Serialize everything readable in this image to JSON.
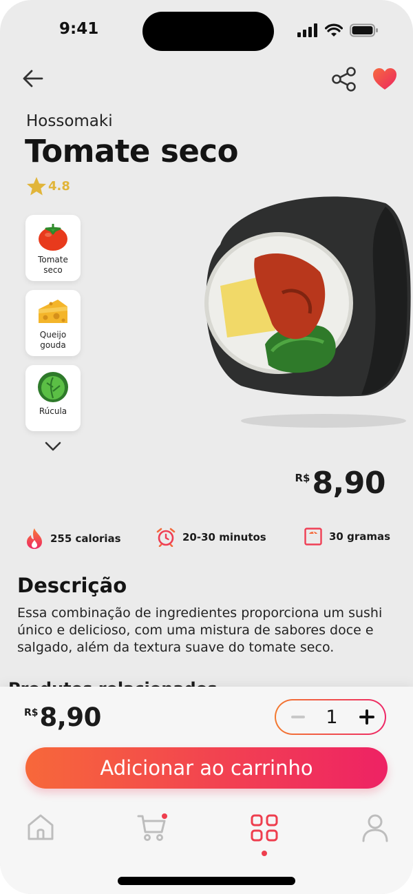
{
  "status": {
    "time": "9:41"
  },
  "product": {
    "category": "Hossomaki",
    "name": "Tomate seco",
    "rating": "4.8",
    "currency": "R$",
    "price": "8,90"
  },
  "ingredients": [
    {
      "label": "Tomate seco",
      "icon": "tomato-icon"
    },
    {
      "label": "Queijo gouda",
      "icon": "cheese-icon"
    },
    {
      "label": "Rúcula",
      "icon": "lettuce-icon"
    }
  ],
  "stats": {
    "calories": "255 calorias",
    "time": "20-30 minutos",
    "weight": "30 gramas"
  },
  "description": {
    "title": "Descrição",
    "text": "Essa combinação de ingredientes proporciona um sushi único e delicioso, com uma mistura de sabores doce e salgado, além da textura suave do tomate seco."
  },
  "next_section_title": "Produtos relacionados",
  "cart": {
    "currency": "R$",
    "price": "8,90",
    "quantity": "1",
    "add_label": "Adicionar ao carrinho"
  },
  "nav": [
    "home-icon",
    "cart-icon",
    "menu-grid-icon",
    "profile-icon"
  ],
  "colors": {
    "accent_start": "#f7683a",
    "accent_end": "#ee2264",
    "star": "#e1b53a",
    "background": "#ebebeb"
  }
}
